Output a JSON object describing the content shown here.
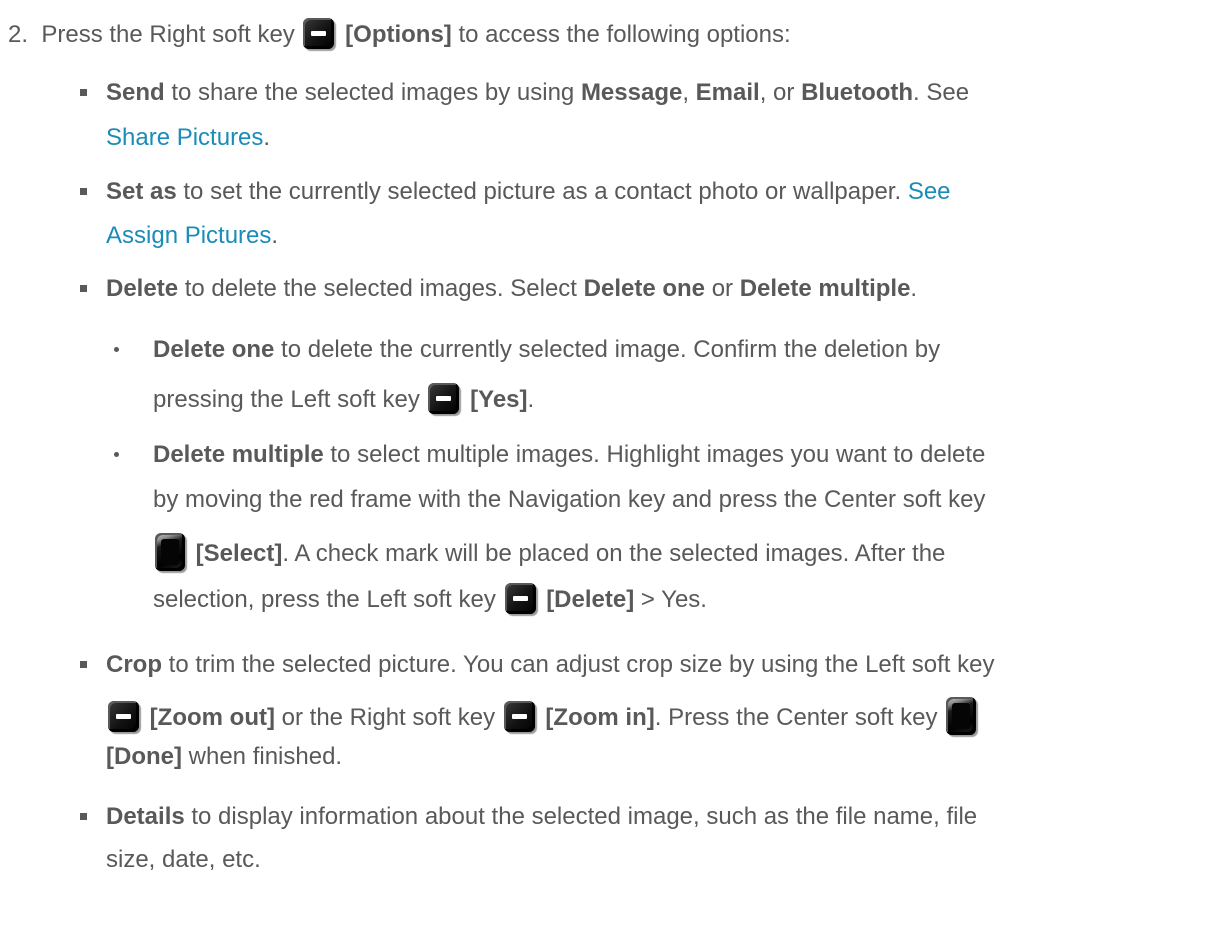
{
  "step_number": "2.",
  "step": {
    "t1": "Press the Right soft key",
    "label": "[Options]",
    "t2": "to access the following options:"
  },
  "send": {
    "term": "Send",
    "t1": "to share the selected images by using",
    "opt1": "Message",
    "sep1": ",",
    "opt2": "Email",
    "sep2": ", or",
    "opt3": "Bluetooth",
    "t2": ". See",
    "link": "Share Pictures",
    "end": "."
  },
  "setas": {
    "term": "Set as",
    "t1": "to set the currently selected picture as a contact photo or wallpaper.",
    "link1": "See",
    "link2": "Assign Pictures",
    "end": "."
  },
  "delete": {
    "term": "Delete",
    "t1": "to delete the selected images. Select",
    "opt1": "Delete one",
    "t2": "or",
    "opt2": "Delete multiple",
    "end": "."
  },
  "delete_one": {
    "term": "Delete one",
    "t1": "to delete the currently selected image. Confirm the deletion by",
    "t2": "pressing the Left soft key",
    "label": "[Yes]",
    "end": "."
  },
  "delete_multiple": {
    "term": "Delete multiple",
    "t1": "to select multiple images. Highlight images you want to delete",
    "line2": "by moving the red frame with the Navigation key and press the Center soft key",
    "label1": "[Select]",
    "t2": ". A check mark will be placed on the selected images. After the",
    "t3": "selection, press the Left soft key",
    "label2": "[Delete]",
    "t4": "> Yes."
  },
  "crop": {
    "term": "Crop",
    "t1": "to trim the selected picture. You can adjust crop size by using the Left soft key",
    "label1": "[Zoom out]",
    "t2": "or the Right soft key",
    "label2": "[Zoom in]",
    "t3": ". Press the Center soft key",
    "label3": "[Done]",
    "t4": "when finished."
  },
  "details": {
    "term": "Details",
    "t1": "to display information about the selected image, such as the file name, file",
    "line2": "size, date, etc."
  },
  "icons": {
    "soft_key": "minus-key-icon",
    "center_key": "center-key-icon",
    "bullet": "square-bullet-icon",
    "sub_bullet": "dot-bullet-icon"
  },
  "colors": {
    "text": "#595959",
    "link": "#1a8cb8"
  }
}
